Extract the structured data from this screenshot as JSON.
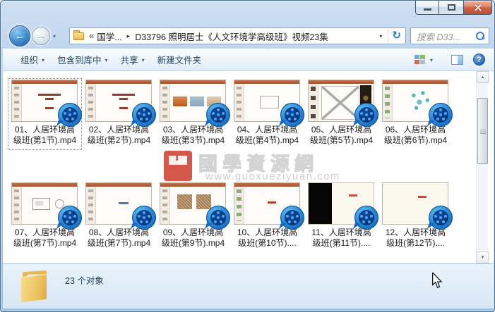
{
  "icons": {
    "crumb_overflow": "«",
    "crumb_separator": "▸",
    "dropdown_caret": "▾",
    "refresh": "↻",
    "back_arrow": "←",
    "forward_arrow": "→",
    "scroll_up": "▲",
    "scroll_down": "▼",
    "help": "?"
  },
  "address": {
    "parent_segment": "国学...",
    "current_segment": "D33796 照明居士《人文环境学高级班》视频23集"
  },
  "search": {
    "placeholder": "搜索 D33..."
  },
  "toolbar": {
    "organize": "组织",
    "include_in_library": "包含到库中",
    "share": "共享",
    "new_folder": "新建文件夹"
  },
  "files": [
    {
      "name": "01、人居环境高级班(第1节).mp4",
      "line1": "01、人居环境高",
      "line2": "级班(第1节).mp4",
      "variant": "title",
      "selected": true
    },
    {
      "name": "02、人居环境高级班(第2节).mp4",
      "line1": "02、人居环境高",
      "line2": "级班(第2节).mp4",
      "variant": "title",
      "selected": false
    },
    {
      "name": "03、人居环境高级班(第3节).mp4",
      "line1": "03、人居环境高",
      "line2": "级班(第3节).mp4",
      "variant": "photos",
      "selected": false
    },
    {
      "name": "04、人居环境高级班(第4节).mp4",
      "line1": "04、人居环境高",
      "line2": "级班(第4节).mp4",
      "variant": "diagram",
      "selected": false
    },
    {
      "name": "05、人居环境高级班(第5节).mp4",
      "line1": "05、人居环境高",
      "line2": "级班(第5节).mp4",
      "variant": "xslide",
      "selected": false
    },
    {
      "name": "06、人居环境高级班(第6节).mp4",
      "line1": "06、人居环境高",
      "line2": "级班(第6节).mp4",
      "variant": "map",
      "selected": false
    },
    {
      "name": "07、人居环境高级班(第7节).mp4",
      "line1": "07、人居环境高",
      "line2": "级班(第7节).mp4",
      "variant": "shapes",
      "selected": false
    },
    {
      "name": "08、人居环境高级班(第7节).mp4",
      "line1": "08、人居环境高",
      "line2": "级班(第7节).mp4",
      "variant": "textblue",
      "selected": false
    },
    {
      "name": "09、人居环境高级班(第9节).mp4",
      "line1": "09、人居环境高",
      "line2": "级班(第9节).mp4",
      "variant": "plans",
      "selected": false
    },
    {
      "name": "10、人居环境高级班(第10节)....",
      "line1": "10、人居环境高",
      "line2": "级班(第10节)....",
      "variant": "textred",
      "selected": false
    },
    {
      "name": "11、人居环境高级班(第11节)....",
      "line1": "11、人居环境高",
      "line2": "级班(第11节)....",
      "variant": "blackleft",
      "selected": false
    },
    {
      "name": "12、人居环境高级班(第12节)....",
      "line1": "12、人居环境高",
      "line2": "级班(第12节)....",
      "variant": "cream",
      "selected": false
    }
  ],
  "watermark": {
    "site_name": "國學資源網",
    "site_url": "www.guoxueziyuan.com"
  },
  "details": {
    "item_count": "23 个对象"
  }
}
